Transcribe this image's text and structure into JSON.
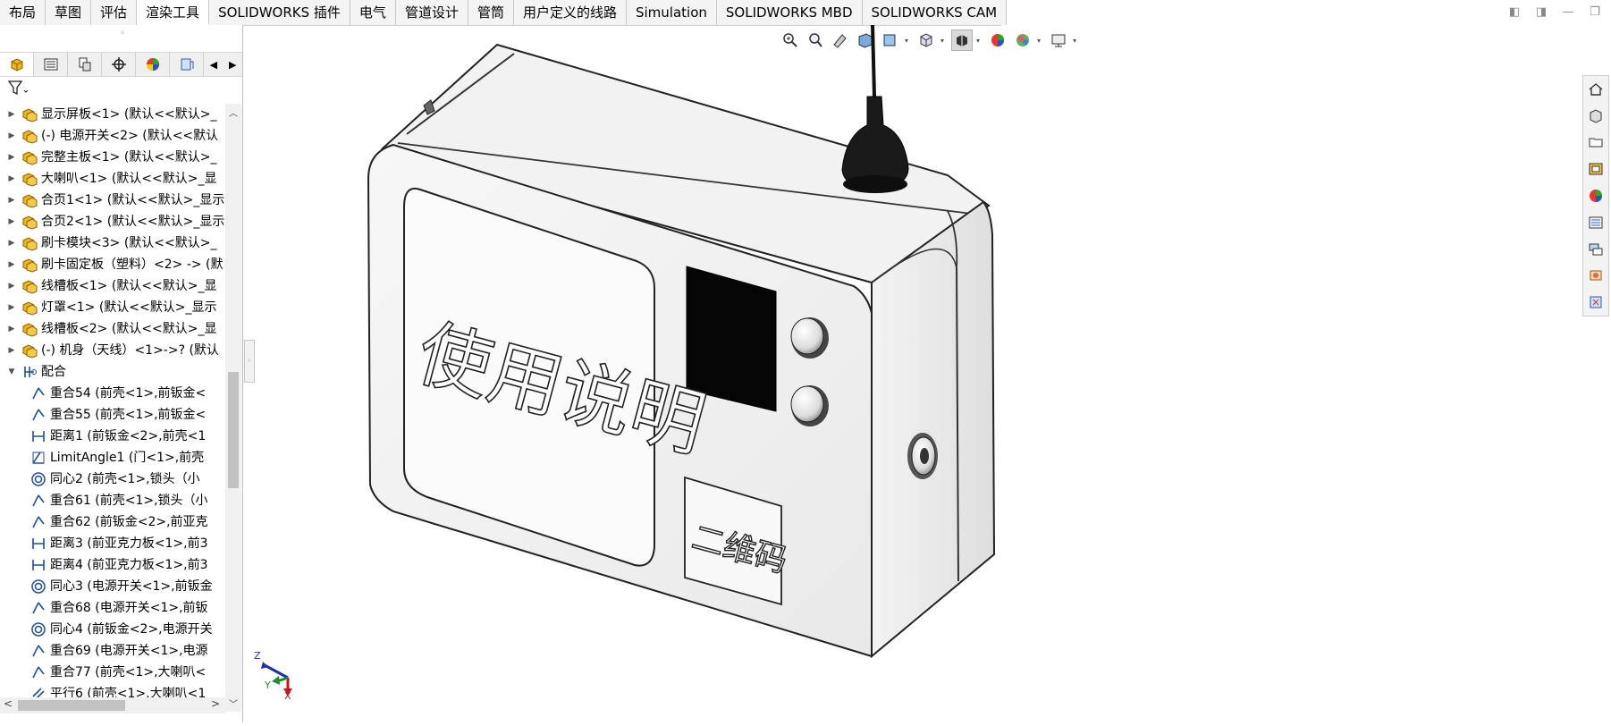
{
  "tabs": [
    "布局",
    "草图",
    "评估",
    "渲染工具",
    "SOLIDWORKS 插件",
    "电气",
    "管道设计",
    "管筒",
    "用户定义的线路",
    "Simulation",
    "SOLIDWORKS MBD",
    "SOLIDWORKS CAM"
  ],
  "active_tab": "渲染工具",
  "window_controls": [
    "pin-left-icon",
    "pin-right-icon",
    "minimize-icon",
    "restore-icon"
  ],
  "manager_tabs": [
    "featuremanager-icon",
    "propertymanager-icon",
    "configurationmanager-icon",
    "dimxpert-icon",
    "display-manager-icon",
    "cam-manager-icon"
  ],
  "tree": {
    "components": [
      {
        "label": "显示屏板<1> (默认<<默认>_"
      },
      {
        "label": "(-) 电源开关<2> (默认<<默认"
      },
      {
        "label": "完整主板<1> (默认<<默认>_"
      },
      {
        "label": "大喇叭<1> (默认<<默认>_显"
      },
      {
        "label": "合页1<1> (默认<<默认>_显示"
      },
      {
        "label": "合页2<1> (默认<<默认>_显示"
      },
      {
        "label": "刷卡模块<3> (默认<<默认>_"
      },
      {
        "label": "刷卡固定板（塑料）<2> -> (默"
      },
      {
        "label": "线槽板<1> (默认<<默认>_显"
      },
      {
        "label": "灯罩<1> (默认<<默认>_显示"
      },
      {
        "label": "线槽板<2> (默认<<默认>_显"
      },
      {
        "label": "(-) 机身（天线）<1>->? (默认"
      }
    ],
    "mates_folder": "配合",
    "mates": [
      {
        "label": "重合54 (前壳<1>,前钣金<",
        "icon": "coincident"
      },
      {
        "label": "重合55 (前壳<1>,前钣金<",
        "icon": "coincident"
      },
      {
        "label": "距离1 (前钣金<2>,前壳<1",
        "icon": "distance"
      },
      {
        "label": "LimitAngle1 (门<1>,前壳",
        "icon": "angle"
      },
      {
        "label": "同心2 (前壳<1>,锁头（小",
        "icon": "concentric"
      },
      {
        "label": "重合61 (前壳<1>,锁头（小",
        "icon": "coincident"
      },
      {
        "label": "重合62 (前钣金<2>,前亚克",
        "icon": "coincident"
      },
      {
        "label": "距离3 (前亚克力板<1>,前3",
        "icon": "distance"
      },
      {
        "label": "距离4 (前亚克力板<1>,前3",
        "icon": "distance"
      },
      {
        "label": "同心3 (电源开关<1>,前钣金",
        "icon": "concentric"
      },
      {
        "label": "重合68 (电源开关<1>,前钣",
        "icon": "coincident"
      },
      {
        "label": "同心4 (前钣金<2>,电源开关",
        "icon": "concentric"
      },
      {
        "label": "重合69 (电源开关<1>,电源",
        "icon": "coincident"
      },
      {
        "label": "重合77 (前壳<1>,大喇叭<",
        "icon": "coincident"
      },
      {
        "label": "平行6 (前壳<1>,大喇叭<1",
        "icon": "parallel"
      }
    ]
  },
  "model": {
    "front_label": "使用说明",
    "qr_label": "二维码",
    "triad": {
      "z": "Z",
      "y": "Y",
      "x": "X"
    }
  },
  "colors": {
    "component_icon": "#f2b21b",
    "mate_icon": "#1f4e9a",
    "triad_z": "#1c2fa8",
    "triad_y": "#1e8a2e",
    "triad_x": "#c4161c"
  }
}
